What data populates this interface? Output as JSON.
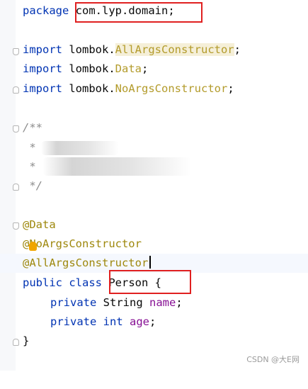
{
  "code": {
    "package_kw": "package",
    "package_name": "com.lyp.domain;",
    "import_kw": "import",
    "import1_pkg": "lombok.",
    "import1_cls": "AllArgsConstructor",
    "import2_pkg": "lombok.",
    "import2_cls": "Data",
    "import3_pkg": "lombok.",
    "import3_cls": "NoArgsConstructor",
    "semicolon": ";",
    "comment_open": "/**",
    "comment_line1": " * ",
    "comment_line2": " * ",
    "comment_close": " */",
    "ann_data": "@Data",
    "ann_noargs": "@NoArgsConstructor",
    "ann_allargs": "@AllArgsConstructor",
    "class_mods": "public class ",
    "class_name": "Person {",
    "field1_mod": "private ",
    "field1_type": "String ",
    "field1_name": "name",
    "field2_mod": "private ",
    "field2_type": "int ",
    "field2_name": "age",
    "close_brace": "}"
  },
  "watermark": "CSDN @大E网",
  "colors": {
    "keyword": "#0033b3",
    "annotation": "#9e880d",
    "field": "#871094",
    "highlight_box": "#e02020"
  }
}
